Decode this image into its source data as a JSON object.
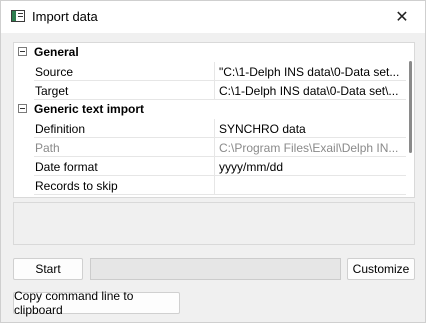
{
  "window": {
    "title": "Import data",
    "icon": "app-window-icon",
    "close_icon": "close-icon"
  },
  "property_grid": {
    "categories": [
      {
        "label": "General",
        "expanded": true,
        "items": [
          {
            "name": "Source",
            "value": "\"C:\\1-Delph INS data\\0-Data set...",
            "disabled": false
          },
          {
            "name": "Target",
            "value": "C:\\1-Delph INS data\\0-Data set\\...",
            "disabled": false
          }
        ]
      },
      {
        "label": "Generic text import",
        "expanded": true,
        "items": [
          {
            "name": "Definition",
            "value": "SYNCHRO data",
            "disabled": false
          },
          {
            "name": "Path",
            "value": "C:\\Program Files\\Exail\\Delph IN...",
            "disabled": true
          },
          {
            "name": "Date format",
            "value": "yyyy/mm/dd",
            "disabled": false
          },
          {
            "name": "Records to skip",
            "value": "",
            "disabled": false
          }
        ]
      }
    ]
  },
  "description": "",
  "buttons": {
    "start": "Start",
    "customize": "Customize",
    "copy_command": "Copy command line to clipboard"
  },
  "progress": {
    "fraction": 0,
    "color": "#06b025"
  }
}
